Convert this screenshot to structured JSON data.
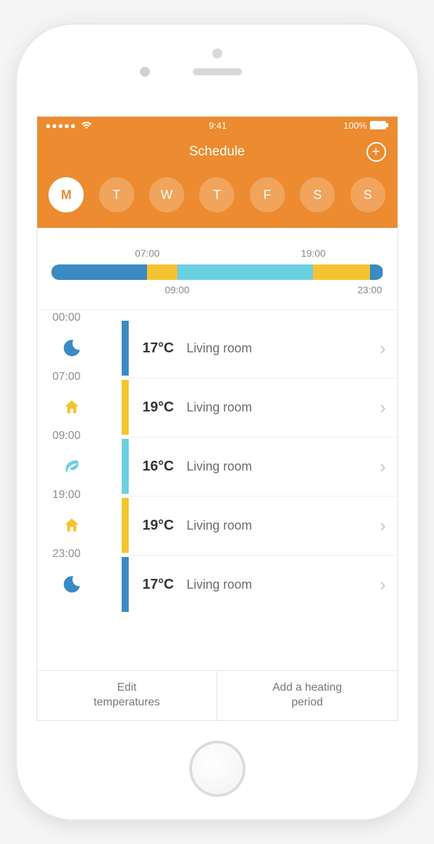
{
  "status": {
    "time": "9:41",
    "battery": "100%"
  },
  "nav": {
    "title": "Schedule"
  },
  "days": [
    {
      "label": "M",
      "selected": true
    },
    {
      "label": "T",
      "selected": false
    },
    {
      "label": "W",
      "selected": false
    },
    {
      "label": "T",
      "selected": false
    },
    {
      "label": "F",
      "selected": false
    },
    {
      "label": "S",
      "selected": false
    },
    {
      "label": "S",
      "selected": false
    }
  ],
  "timeline": {
    "top_labels": [
      {
        "text": "07:00",
        "pos": 29
      },
      {
        "text": "19:00",
        "pos": 79
      }
    ],
    "bottom_labels": [
      {
        "text": "09:00",
        "pos": 38
      },
      {
        "text": "23:00",
        "pos": 96
      }
    ],
    "segments": [
      {
        "color": "c-blue",
        "width": 29
      },
      {
        "color": "c-yellow",
        "width": 9
      },
      {
        "color": "c-cyan",
        "width": 41
      },
      {
        "color": "c-yellow",
        "width": 17
      },
      {
        "color": "c-blue",
        "width": 4
      }
    ]
  },
  "periods": [
    {
      "time": "00:00",
      "icon": "moon",
      "stripe": "c-blue",
      "temp": "17°C",
      "room": "Living room"
    },
    {
      "time": "07:00",
      "icon": "home",
      "stripe": "c-yellow",
      "temp": "19°C",
      "room": "Living room"
    },
    {
      "time": "09:00",
      "icon": "leaf",
      "stripe": "c-cyan",
      "temp": "16°C",
      "room": "Living room"
    },
    {
      "time": "19:00",
      "icon": "home",
      "stripe": "c-yellow",
      "temp": "19°C",
      "room": "Living room"
    },
    {
      "time": "23:00",
      "icon": "moon",
      "stripe": "c-blue",
      "temp": "17°C",
      "room": "Living room"
    }
  ],
  "actions": {
    "edit": "Edit\ntemperatures",
    "add": "Add a heating\nperiod"
  },
  "colors": {
    "blue": "#3b8ac4",
    "yellow": "#f4c430",
    "cyan": "#6bd0e2",
    "orange": "#ec8b2f"
  }
}
